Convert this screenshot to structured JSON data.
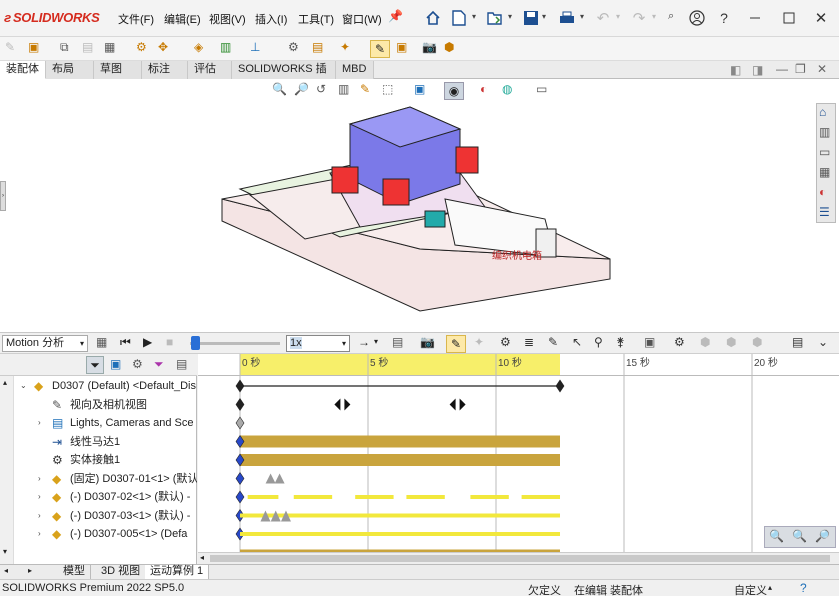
{
  "app": {
    "logo_text": "SOLIDWORKS"
  },
  "menu": [
    "文件(F)",
    "编辑(E)",
    "视图(V)",
    "插入(I)",
    "工具(T)",
    "窗口(W)"
  ],
  "tabs": {
    "items": [
      "装配体",
      "布局",
      "草图",
      "标注",
      "评估",
      "SOLIDWORKS 插件",
      "MBD"
    ],
    "active": "装配体"
  },
  "model": {
    "label_text": "编织机电箱"
  },
  "motion": {
    "study_type": "Motion 分析",
    "speed": "1x",
    "time_labels": [
      "0 秒",
      "5 秒",
      "10 秒",
      "15 秒",
      "20 秒"
    ]
  },
  "tree": {
    "items": [
      {
        "label": "D0307 (Default) <Default_Dis",
        "icon": "assembly-icon",
        "expand": "collapse"
      },
      {
        "label": "视向及相机视图",
        "icon": "camera-icon",
        "expand": ""
      },
      {
        "label": "Lights, Cameras and Sce",
        "icon": "lights-icon",
        "expand": "expand"
      },
      {
        "label": "线性马达1",
        "icon": "motor-icon",
        "expand": ""
      },
      {
        "label": "实体接触1",
        "icon": "contact-icon",
        "expand": ""
      },
      {
        "label": "(固定) D0307-01<1> (默认",
        "icon": "part-icon",
        "expand": "expand"
      },
      {
        "label": "(-) D0307-02<1> (默认) -",
        "icon": "part-icon",
        "expand": "expand"
      },
      {
        "label": "(-) D0307-03<1> (默认) -",
        "icon": "part-icon",
        "expand": "expand"
      },
      {
        "label": "(-) D0307-005<1> (Defa",
        "icon": "part-icon",
        "expand": "expand"
      }
    ]
  },
  "bottom_tabs": {
    "items": [
      "模型",
      "3D 视图",
      "运动算例 1"
    ],
    "active": "运动算例 1"
  },
  "status": {
    "product": "SOLIDWORKS Premium 2022 SP5.0",
    "state": "欠定义",
    "mode": "在编辑 装配体",
    "units": "自定义"
  },
  "colors": {
    "timeline_highlight": "#f7ef6a",
    "bar_gold": "#c9a43d",
    "bar_yellow": "#f2e83c",
    "key_blue": "#2848c8",
    "brand_red": "#d52b1e"
  }
}
